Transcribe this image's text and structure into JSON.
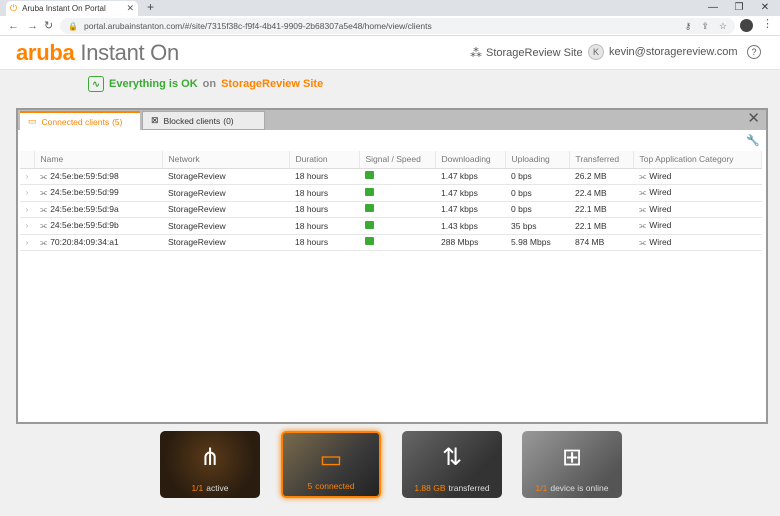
{
  "browser": {
    "tab_title": "Aruba Instant On Portal",
    "tab_close": "✕",
    "new_tab": "+",
    "url": "portal.arubainstanton.com/#/site/7315f38c-f9f4-4b41-9909-2b68307a5e48/home/view/clients",
    "window_controls": [
      "—",
      "❐",
      "✕"
    ]
  },
  "header": {
    "logo_brand": "aruba",
    "logo_product": "Instant On",
    "site_label": "StorageReview Site",
    "user_initial": "K",
    "user_email": "kevin@storagereview.com",
    "help_label": "?"
  },
  "status": {
    "message": "Everything is OK",
    "on": "on",
    "site": "StorageReview Site"
  },
  "panel": {
    "tabs": [
      {
        "label": "Connected clients",
        "count": "(5)"
      },
      {
        "label": "Blocked clients",
        "count": "(0)"
      }
    ],
    "columns": [
      "Name",
      "Network",
      "Duration",
      "Signal / Speed",
      "Downloading",
      "Uploading",
      "Transferred",
      "Top Application Category"
    ],
    "rows": [
      {
        "name": "24:5e:be:59:5d:98",
        "network": "StorageReview",
        "duration": "18 hours",
        "down": "1.47 kbps",
        "up": "0 bps",
        "transferred": "26.2 MB",
        "category": "Wired"
      },
      {
        "name": "24:5e:be:59:5d:99",
        "network": "StorageReview",
        "duration": "18 hours",
        "down": "1.47 kbps",
        "up": "0 bps",
        "transferred": "22.4 MB",
        "category": "Wired"
      },
      {
        "name": "24:5e:be:59:5d:9a",
        "network": "StorageReview",
        "duration": "18 hours",
        "down": "1.47 kbps",
        "up": "0 bps",
        "transferred": "22.1 MB",
        "category": "Wired"
      },
      {
        "name": "24:5e:be:59:5d:9b",
        "network": "StorageReview",
        "duration": "18 hours",
        "down": "1.43 kbps",
        "up": "35 bps",
        "transferred": "22.1 MB",
        "category": "Wired"
      },
      {
        "name": "70:20:84:09:34:a1",
        "network": "StorageReview",
        "duration": "18 hours",
        "down": "288 Mbps",
        "up": "5.98 Mbps",
        "transferred": "874 MB",
        "category": "Wired"
      }
    ]
  },
  "tiles": [
    {
      "num": "1/1",
      "text": "active"
    },
    {
      "num": "5",
      "text": "connected"
    },
    {
      "num": "1.88 GB",
      "text": "transferred"
    },
    {
      "num": "1/1",
      "text": "device is online"
    }
  ],
  "colors": {
    "accent": "#ff8300",
    "ok": "#3aaa35"
  }
}
